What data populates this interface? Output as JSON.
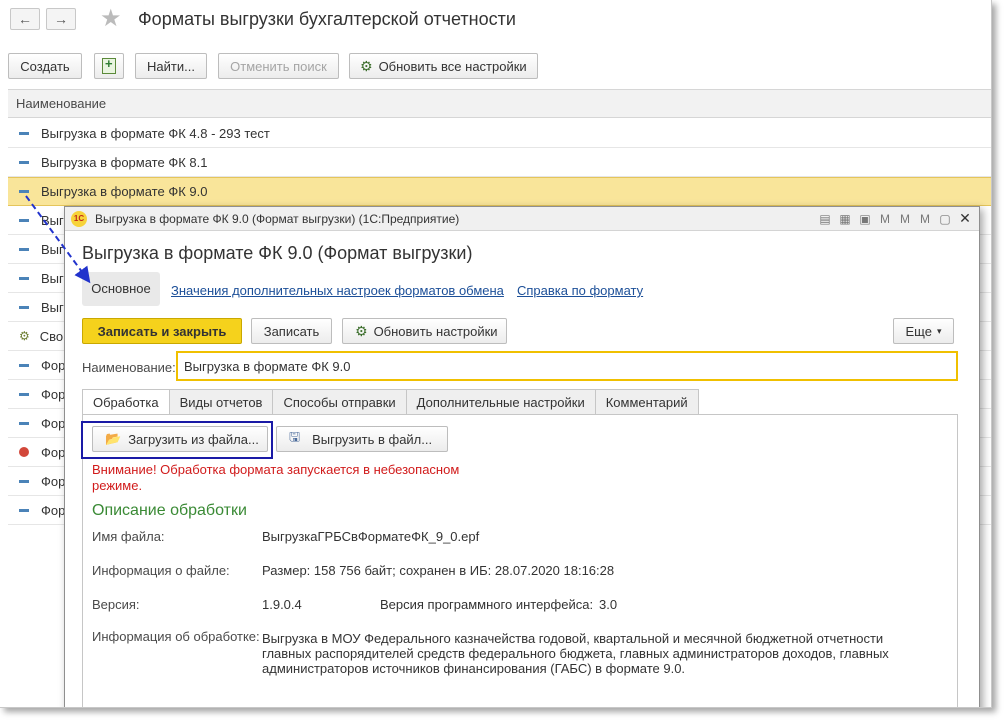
{
  "window": {
    "title": "Форматы выгрузки бухгалтерской отчетности",
    "nav_back": "←",
    "nav_forward": "→",
    "star": "★"
  },
  "toolbar": {
    "create": "Создать",
    "find": "Найти...",
    "cancel_search": "Отменить поиск",
    "refresh_all": "Обновить все настройки"
  },
  "list": {
    "header": "Наименование",
    "rows": [
      {
        "label": "Выгрузка в формате ФК 4.8 - 293 тест",
        "icon": "dash-icon"
      },
      {
        "label": "Выгрузка в формате ФК 8.1",
        "icon": "dash-icon"
      },
      {
        "label": "Выгрузка в формате ФК 9.0",
        "icon": "dash-icon",
        "selected": true
      },
      {
        "label": "Выг",
        "icon": "dash-icon"
      },
      {
        "label": "Выг",
        "icon": "dash-icon"
      },
      {
        "label": "Выг",
        "icon": "dash-icon"
      },
      {
        "label": "Выг",
        "icon": "dash-icon"
      },
      {
        "label": "Сво",
        "icon": "gear-icon"
      },
      {
        "label": "Фор",
        "icon": "dash-icon"
      },
      {
        "label": "Фор",
        "icon": "dash-icon"
      },
      {
        "label": "Фор",
        "icon": "dash-icon"
      },
      {
        "label": "Фор",
        "icon": "red-circle-icon"
      },
      {
        "label": "Фор",
        "icon": "dash-icon"
      },
      {
        "label": "Фор",
        "icon": "dash-icon"
      }
    ]
  },
  "dialog": {
    "window_title": "Выгрузка в формате ФК 9.0 (Формат выгрузки)  (1С:Предприятие)",
    "logo": "1С",
    "heading": "Выгрузка в формате ФК 9.0 (Формат выгрузки)",
    "nav": {
      "main": "Основное",
      "link1": "Значения дополнительных настроек форматов обмена",
      "link2": "Справка по формату"
    },
    "buttons": {
      "save_close": "Записать и закрыть",
      "save": "Записать",
      "refresh": "Обновить настройки",
      "more": "Еще"
    },
    "name_label": "Наименование:",
    "name_value": "Выгрузка в формате ФК 9.0",
    "tabs": [
      "Обработка",
      "Виды отчетов",
      "Способы отправки",
      "Дополнительные настройки",
      "Комментарий"
    ],
    "processing": {
      "load_button": "Загрузить из файла...",
      "unload_button": "Выгрузить в файл...",
      "warning": "Внимание! Обработка формата запускается в небезопасном режиме.",
      "section_title": "Описание обработки",
      "file_name_label": "Имя файла:",
      "file_name_value": "ВыгрузкаГРБСвФорматеФК_9_0.epf",
      "file_info_label": "Информация о файле:",
      "file_info_value": "Размер: 158 756 байт; сохранен в ИБ: 28.07.2020 18:16:28",
      "version_label": "Версия:",
      "version_value": "1.9.0.4",
      "api_version_label": "Версия программного интерфейса:",
      "api_version_value": "3.0",
      "processing_info_label": "Информация об обработке:",
      "processing_info_value": "Выгрузка в МОУ Федерального казначейства годовой, квартальной и месячной бюджетной отчетности главных распорядителей средств федерального бюджета, главных администраторов доходов, главных администраторов источников финансирования (ГАБС) в формате 9.0."
    }
  },
  "colors": {
    "selected_row": "#f9e59a",
    "primary_button": "#f5d21c",
    "link": "#1c4f98",
    "warning": "#d11b1b",
    "section_title": "#3a8a35",
    "highlight_box": "#1a1aa6",
    "arrow": "#2233cc"
  }
}
